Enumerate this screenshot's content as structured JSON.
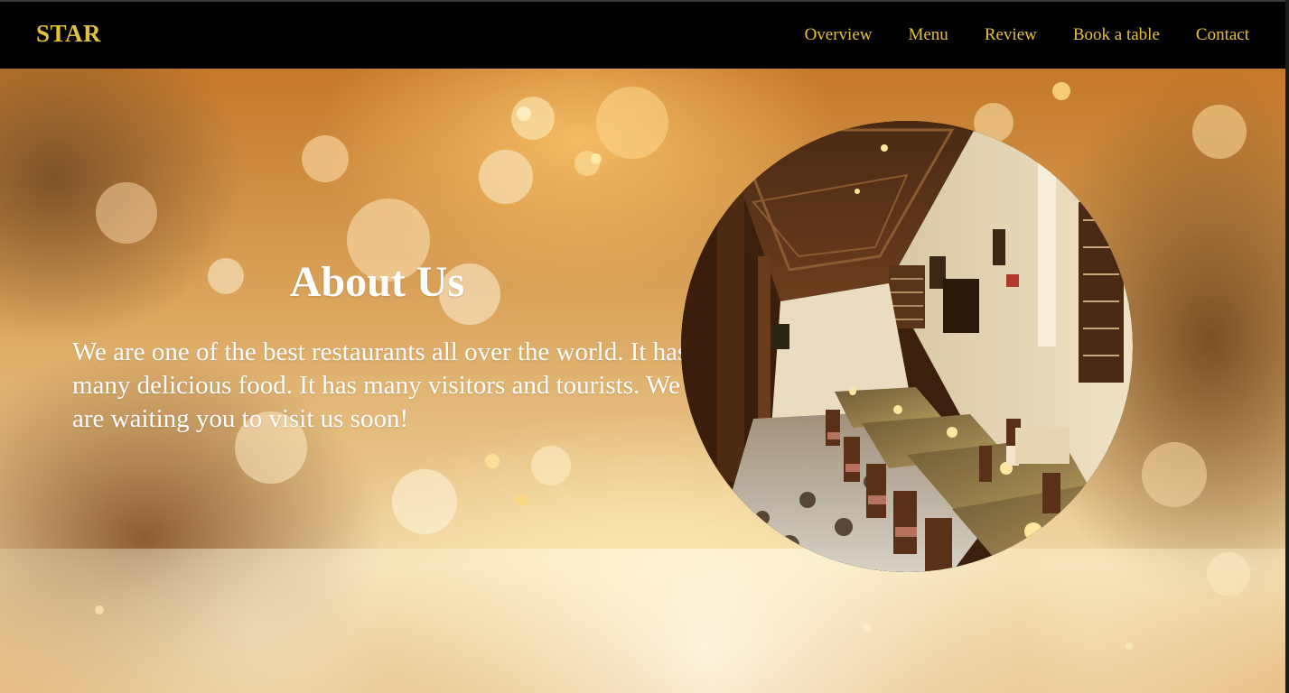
{
  "navbar": {
    "brand": "STAR",
    "links": [
      {
        "label": "Overview"
      },
      {
        "label": "Menu"
      },
      {
        "label": "Review"
      },
      {
        "label": "Book a table"
      },
      {
        "label": "Contact"
      }
    ]
  },
  "about": {
    "title": "About Us",
    "text": "We are one of the best restaurants all over the world. It has many delicious food. It has many visitors and tourists. We are waiting you to visit us soon!"
  },
  "colors": {
    "navbar_bg": "#000000",
    "accent": "#e4c13a",
    "text": "#ffffff"
  },
  "images": {
    "hero_background": "golden-bokeh-background",
    "restaurant_photo": "restaurant-interior-photo"
  }
}
